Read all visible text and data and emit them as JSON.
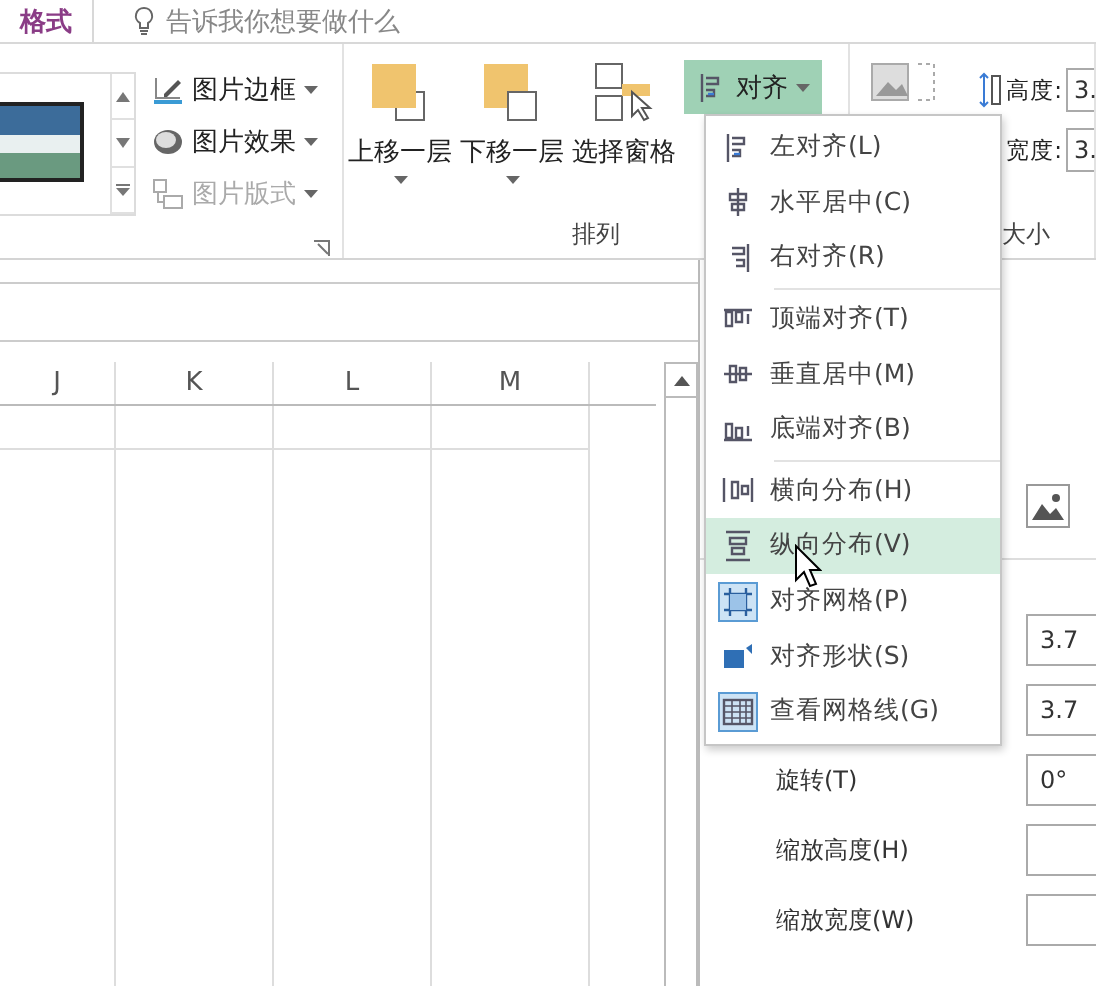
{
  "ribbon": {
    "tabs": [
      {
        "label": "格式",
        "selected": true
      }
    ],
    "tell_me": {
      "placeholder": "告诉我你想要做什么"
    },
    "picture_styles": {
      "buttons": [
        {
          "label": "图片边框",
          "kind": "border",
          "disabled": false
        },
        {
          "label": "图片效果",
          "kind": "effects",
          "disabled": false
        },
        {
          "label": "图片版式",
          "kind": "layout",
          "disabled": true
        }
      ]
    },
    "arrange": {
      "label": "排列",
      "buttons": [
        {
          "label": "上移一层",
          "kind": "forward"
        },
        {
          "label": "下移一层",
          "kind": "backward"
        },
        {
          "label": "选择窗格",
          "kind": "pane"
        }
      ],
      "align_button": {
        "label": "对齐",
        "selected": true
      }
    },
    "size": {
      "label": "大小",
      "fields": [
        {
          "label": "高度:",
          "value": "3."
        },
        {
          "label": "宽度:",
          "value": "3."
        }
      ]
    }
  },
  "sheet": {
    "columns": [
      "J",
      "K",
      "L",
      "M"
    ]
  },
  "pane": {
    "fields": [
      {
        "value": "3.7"
      },
      {
        "value": "3.7"
      },
      {
        "label": "旋转(T)",
        "value": "0°"
      },
      {
        "label": "缩放高度(H)"
      },
      {
        "label": "缩放宽度(W)"
      }
    ]
  },
  "align_menu": {
    "items": [
      {
        "label": "左对齐(L)",
        "kind": "left",
        "selected": false,
        "checked": false
      },
      {
        "label": "水平居中(C)",
        "kind": "hcenter",
        "selected": false,
        "checked": false
      },
      {
        "label": "右对齐(R)",
        "kind": "right",
        "selected": false,
        "checked": false
      },
      {
        "label": "顶端对齐(T)",
        "kind": "top",
        "selected": false,
        "checked": false,
        "separator_before": true
      },
      {
        "label": "垂直居中(M)",
        "kind": "vcenter",
        "selected": false,
        "checked": false
      },
      {
        "label": "底端对齐(B)",
        "kind": "bottom",
        "selected": false,
        "checked": false
      },
      {
        "label": "横向分布(H)",
        "kind": "hdist",
        "selected": false,
        "checked": false,
        "separator_before": true
      },
      {
        "label": "纵向分布(V)",
        "kind": "vdist",
        "selected": true,
        "checked": false
      },
      {
        "label": "对齐网格(P)",
        "kind": "grid",
        "selected": false,
        "checked": true
      },
      {
        "label": "对齐形状(S)",
        "kind": "shape",
        "selected": false,
        "checked": false
      },
      {
        "label": "查看网格线(G)",
        "kind": "gridlines",
        "selected": false,
        "checked": true
      }
    ]
  }
}
